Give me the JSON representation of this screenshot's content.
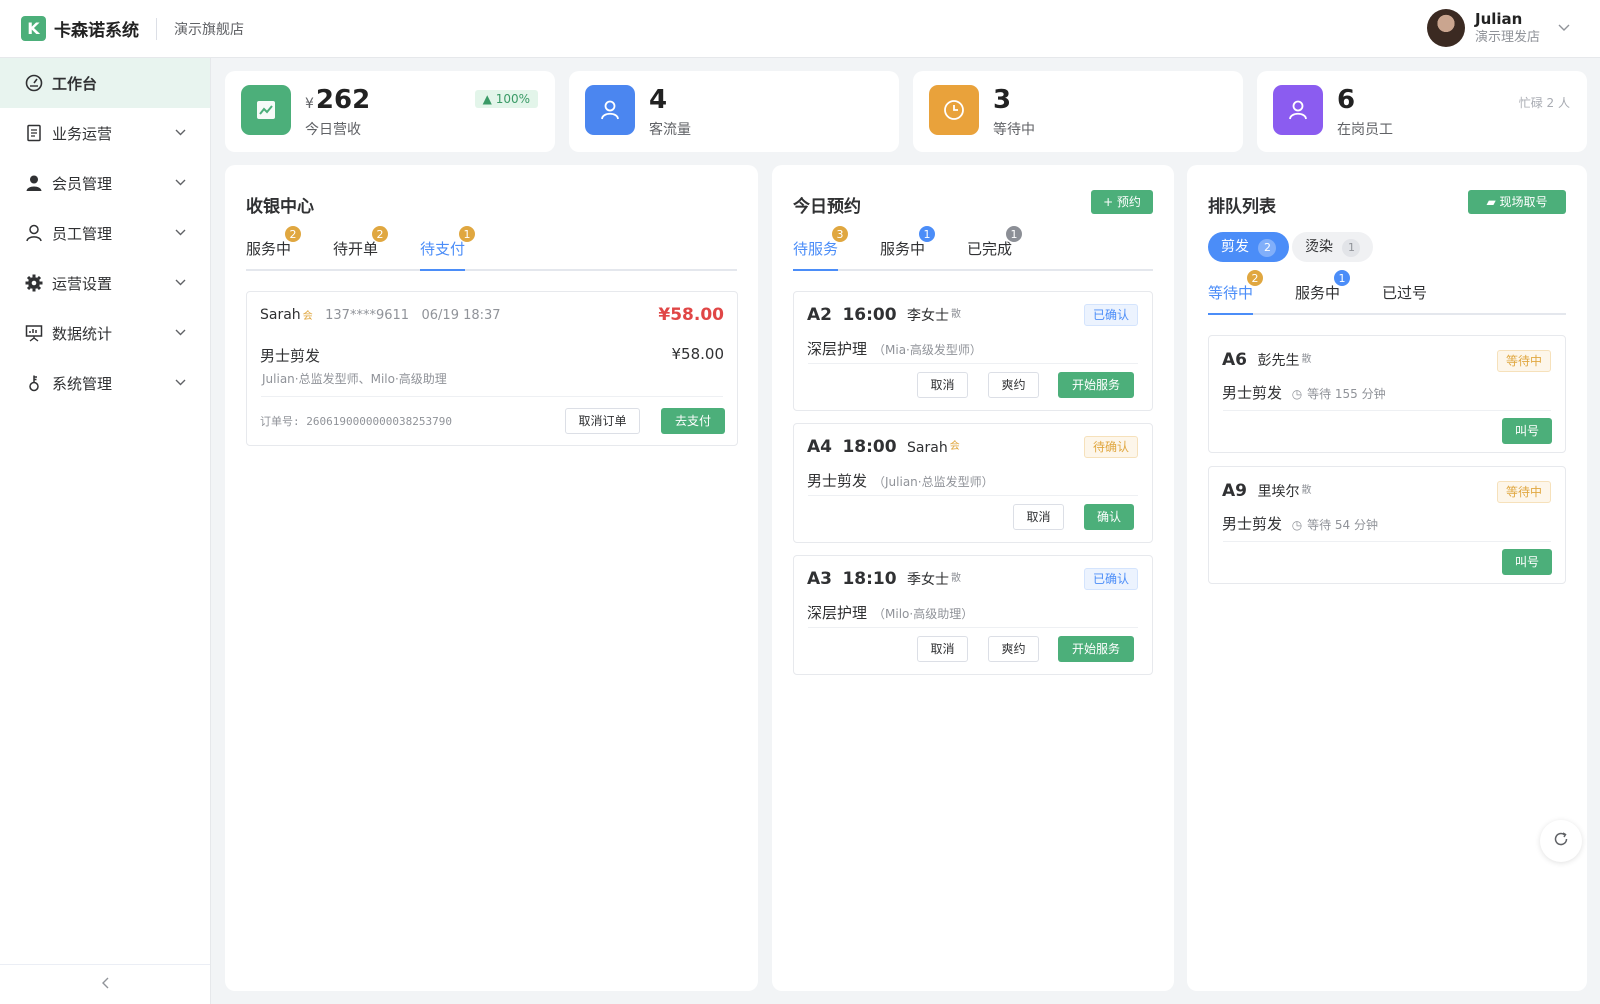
{
  "header": {
    "logo_letter": "K",
    "system_name": "卡森诺系统",
    "store_name": "演示旗舰店",
    "user_name": "Julian",
    "user_store": "演示理发店"
  },
  "sidebar": {
    "items": [
      {
        "label": "工作台",
        "icon": "dashboard-icon"
      },
      {
        "label": "业务运营",
        "icon": "document-icon"
      },
      {
        "label": "会员管理",
        "icon": "user-filled-icon"
      },
      {
        "label": "员工管理",
        "icon": "user-icon"
      },
      {
        "label": "运营设置",
        "icon": "gear-icon"
      },
      {
        "label": "数据统计",
        "icon": "presentation-chart-icon"
      },
      {
        "label": "系统管理",
        "icon": "key-icon"
      }
    ],
    "collapse_icon": "chevron-left-icon"
  },
  "stats": [
    {
      "currency": "¥",
      "value": "262",
      "label": "今日营收",
      "badge": "100%",
      "color": "#4caf7a",
      "icon": "trend-chart-icon"
    },
    {
      "value": "4",
      "label": "客流量",
      "color": "#4b86f0",
      "icon": "user-icon"
    },
    {
      "value": "3",
      "label": "等待中",
      "color": "#e9a23b",
      "icon": "clock-icon"
    },
    {
      "value": "6",
      "label": "在岗员工",
      "note": "忙碌 2 人",
      "color": "#8b5cf0",
      "icon": "user-icon"
    }
  ],
  "cashier": {
    "title": "收银中心",
    "tabs": [
      {
        "label": "服务中",
        "count": "2"
      },
      {
        "label": "待开单",
        "count": "2"
      },
      {
        "label": "待支付",
        "count": "1"
      }
    ],
    "order": {
      "customer": "Sarah",
      "member_mark": "会",
      "phone": "137****9611",
      "time": "06/19 18:37",
      "total": "¥58.00",
      "service": "男士剪发",
      "service_price": "¥58.00",
      "staff": "Julian·总监发型师、Milo·高级助理",
      "order_no": "订单号: 2606190000000038253790",
      "cancel_label": "取消订单",
      "pay_label": "去支付"
    }
  },
  "appointments": {
    "title": "今日预约",
    "add_label": "+ 预约",
    "tabs": [
      {
        "label": "待服务",
        "count": "3"
      },
      {
        "label": "服务中",
        "count": "1"
      },
      {
        "label": "已完成",
        "count": "1"
      }
    ],
    "items": [
      {
        "code": "A2",
        "time": "16:00",
        "name": "李女士",
        "mark": "散",
        "status": "已确认",
        "service": "深层护理",
        "staff": "（Mia·高级发型师）",
        "btn1": "取消",
        "btn2": "爽约",
        "btn3": "开始服务"
      },
      {
        "code": "A4",
        "time": "18:00",
        "name": "Sarah",
        "mark": "会",
        "status": "待确认",
        "service": "男士剪发",
        "staff": "（Julian·总监发型师）",
        "btn1": "取消",
        "btn3": "确认"
      },
      {
        "code": "A3",
        "time": "18:10",
        "name": "季女士",
        "mark": "散",
        "status": "已确认",
        "service": "深层护理",
        "staff": "（Milo·高级助理）",
        "btn1": "取消",
        "btn2": "爽约",
        "btn3": "开始服务"
      }
    ]
  },
  "queue": {
    "title": "排队列表",
    "ticket_label": "现场取号",
    "categories": [
      {
        "label": "剪发",
        "count": "2"
      },
      {
        "label": "烫染",
        "count": "1"
      }
    ],
    "tabs": [
      {
        "label": "等待中",
        "count": "2"
      },
      {
        "label": "服务中",
        "count": "1"
      },
      {
        "label": "已过号"
      }
    ],
    "items": [
      {
        "code": "A6",
        "name": "彭先生",
        "mark": "散",
        "status": "等待中",
        "service": "男士剪发",
        "wait": "等待 155 分钟",
        "call": "叫号"
      },
      {
        "code": "A9",
        "name": "里埃尔",
        "mark": "散",
        "status": "等待中",
        "service": "男士剪发",
        "wait": "等待 54 分钟",
        "call": "叫号"
      }
    ]
  },
  "refresh_icon": "refresh-icon"
}
